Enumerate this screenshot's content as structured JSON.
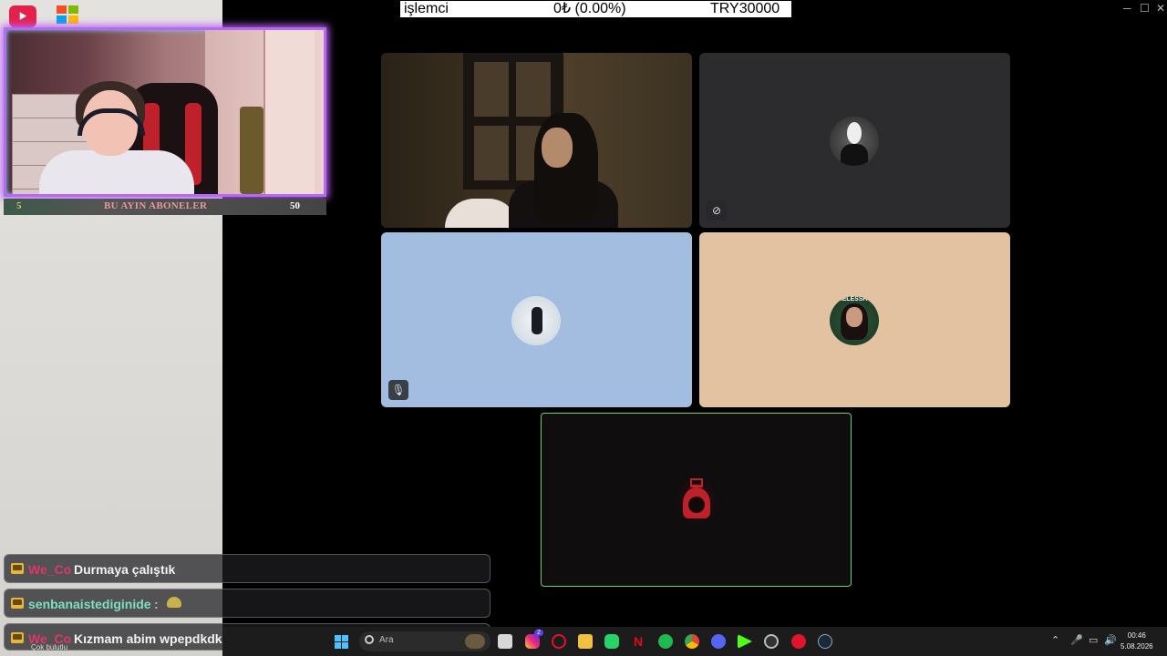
{
  "info_bar": {
    "label": "işlemci",
    "change": "0₺ (0.00%)",
    "value": "TRY30000"
  },
  "overlay": {
    "sub_goal_current": "5",
    "sub_goal_title": "BU AYIN ABONELER",
    "sub_goal_target": "50"
  },
  "chat": [
    {
      "user": "We_Co",
      "message": "Durmaya çalıştık",
      "user_color": "#e0366a"
    },
    {
      "user": "senbanaistediginide",
      "message": "",
      "user_color": "#7ee0c0"
    },
    {
      "user": "We_Co",
      "message": "Kızmam abim wpepdkdk",
      "user_color": "#e0366a"
    }
  ],
  "participants": [
    {
      "name": "tile-1",
      "type": "video"
    },
    {
      "name": "tile-2",
      "type": "avatar",
      "muted": true
    },
    {
      "name": "tile-3",
      "type": "avatar",
      "muted": true
    },
    {
      "name": "tile-4",
      "type": "avatar",
      "avatar_text": "OMELESSRUN"
    },
    {
      "name": "tile-5",
      "type": "avatar",
      "speaking": true
    }
  ],
  "taskbar": {
    "search_placeholder": "Ara",
    "weather_caption": "Çok bulutlu",
    "time": "00:46",
    "date": "5.08.2026",
    "badge_instagram": "2"
  },
  "colors": {
    "speaking_border": "#5fcf7a",
    "overlay_glow": "#c05cff",
    "app_logo": "#e5214b"
  }
}
